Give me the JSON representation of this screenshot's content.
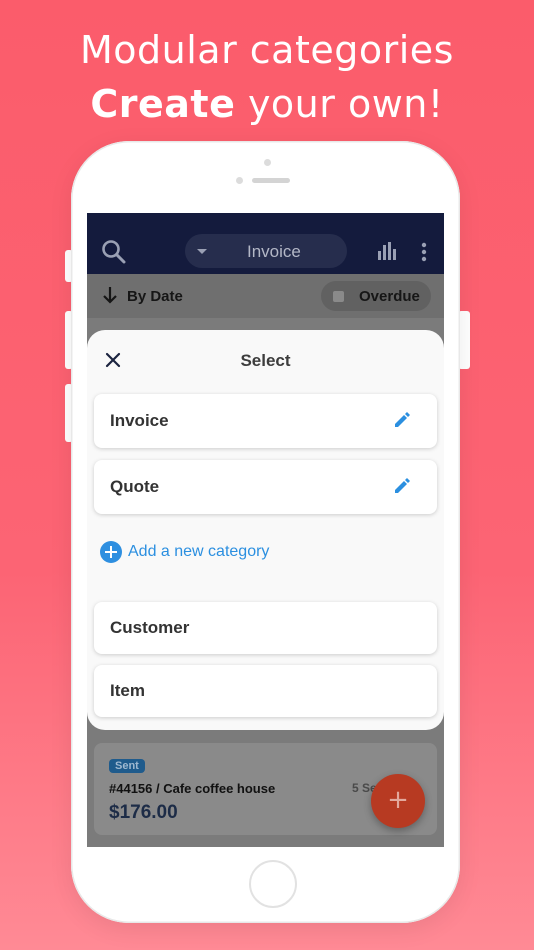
{
  "promo": {
    "line1": "Modular categories",
    "line2_bold": "Create",
    "line2_rest": " your own!"
  },
  "appbar": {
    "title": "Invoice",
    "icons": [
      "search-icon",
      "dropdown-caret-icon",
      "bar-chart-icon",
      "more-vertical-icon"
    ]
  },
  "sortbar": {
    "sort_label": "By Date",
    "filter_label": "Overdue"
  },
  "sheet": {
    "title": "Select",
    "categories": [
      {
        "label": "Invoice",
        "editable": true
      },
      {
        "label": "Quote",
        "editable": true
      }
    ],
    "add_label": "Add a new category",
    "fixed_categories": [
      {
        "label": "Customer"
      },
      {
        "label": "Item"
      }
    ]
  },
  "invoice_item": {
    "status": "Sent",
    "reference": "#44156 / Cafe coffee house",
    "date": "5 Se",
    "amount": "$176.00"
  },
  "fab": {
    "label": "+"
  },
  "colors": {
    "background": "#fb5c6b",
    "appbar": "#141b3d",
    "accent": "#2b8fe0",
    "fab": "#b73a22"
  }
}
